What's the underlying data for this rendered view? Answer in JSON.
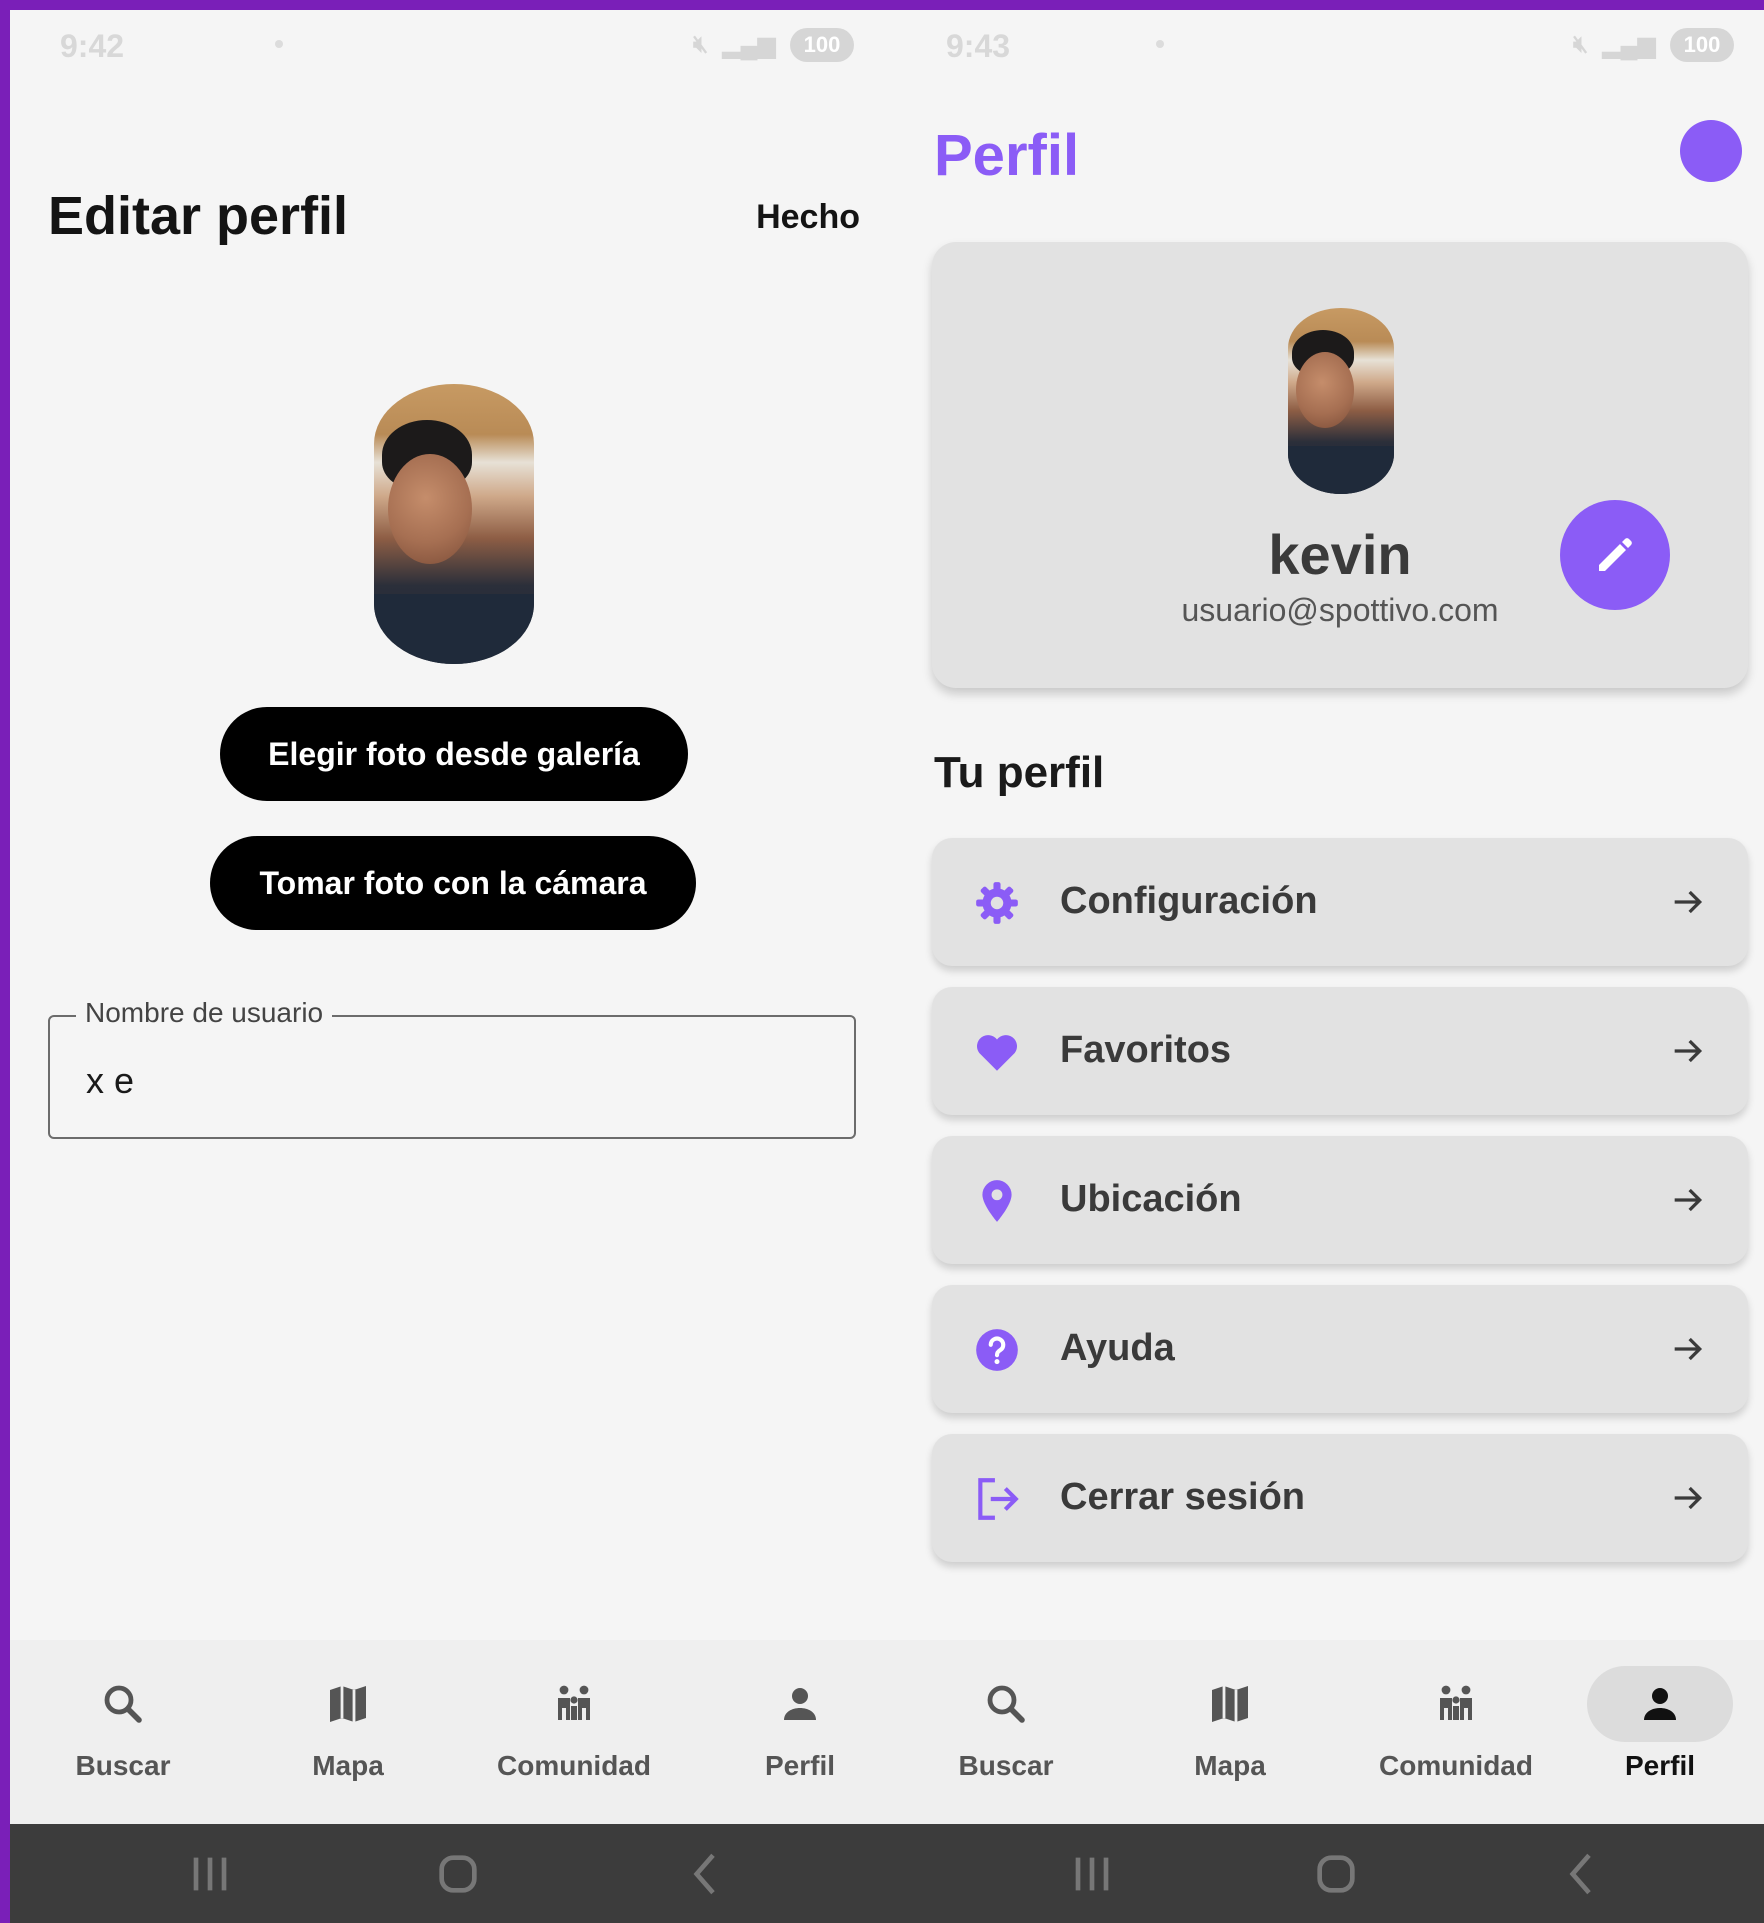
{
  "colors": {
    "accent": "#8b5cf6",
    "frame": "#7a1fb8",
    "background": "#f5f5f5",
    "card": "#e2e2e2",
    "button_dark": "#000000"
  },
  "left": {
    "status": {
      "time": "9:42",
      "battery": "100"
    },
    "title": "Editar perfil",
    "done_label": "Hecho",
    "gallery_button_label": "Elegir foto desde galería",
    "camera_button_label": "Tomar foto con la cámara",
    "username": {
      "label": "Nombre de usuario",
      "value": "x e"
    },
    "nav": [
      {
        "label": "Buscar",
        "icon": "search-icon"
      },
      {
        "label": "Mapa",
        "icon": "map-icon"
      },
      {
        "label": "Comunidad",
        "icon": "community-icon"
      },
      {
        "label": "Perfil",
        "icon": "person-icon"
      }
    ]
  },
  "right": {
    "status": {
      "time": "9:43",
      "battery": "100"
    },
    "title": "Perfil",
    "user": {
      "name": "kevin",
      "email": "usuario@spottivo.com"
    },
    "section_title": "Tu perfil",
    "menu": [
      {
        "label": "Configuración",
        "icon": "gear-icon"
      },
      {
        "label": "Favoritos",
        "icon": "heart-icon"
      },
      {
        "label": "Ubicación",
        "icon": "location-pin-icon"
      },
      {
        "label": "Ayuda",
        "icon": "help-icon"
      },
      {
        "label": "Cerrar sesión",
        "icon": "logout-icon"
      }
    ],
    "nav": [
      {
        "label": "Buscar",
        "icon": "search-icon"
      },
      {
        "label": "Mapa",
        "icon": "map-icon"
      },
      {
        "label": "Comunidad",
        "icon": "community-icon"
      },
      {
        "label": "Perfil",
        "icon": "person-icon",
        "active": true
      }
    ]
  }
}
